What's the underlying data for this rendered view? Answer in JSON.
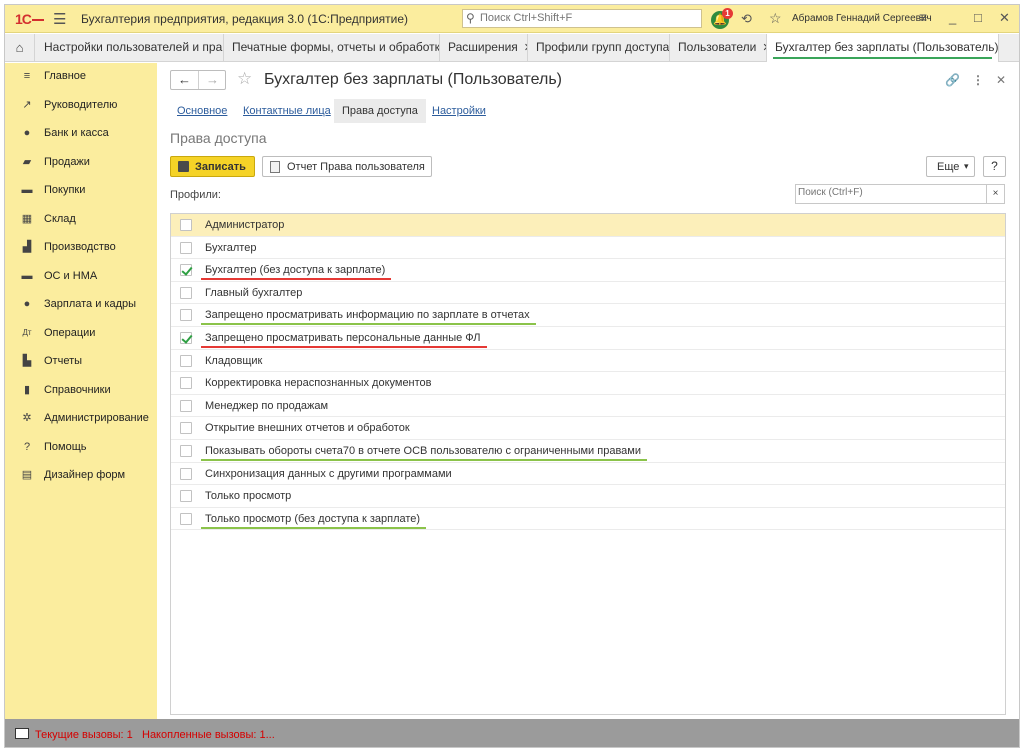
{
  "titlebar": {
    "logo": "1С",
    "app_title": "Бухгалтерия предприятия, редакция 3.0  (1С:Предприятие)",
    "search_placeholder": "Поиск Ctrl+Shift+F",
    "notification_count": "1",
    "user_name": "Абрамов Геннадий Сергеевич"
  },
  "tabs": [
    {
      "label": "Настройки пользователей и прав"
    },
    {
      "label": "Печатные формы, отчеты и обработки"
    },
    {
      "label": "Расширения"
    },
    {
      "label": "Профили групп доступа"
    },
    {
      "label": "Пользователи"
    },
    {
      "label": "Бухгалтер без зарплаты (Пользователь)",
      "active": true
    }
  ],
  "sidebar": {
    "items": [
      {
        "label": "Главное",
        "icon": "menu-icon"
      },
      {
        "label": "Руководителю",
        "icon": "trend-icon"
      },
      {
        "label": "Банк и касса",
        "icon": "ruble-icon"
      },
      {
        "label": "Продажи",
        "icon": "bag-icon"
      },
      {
        "label": "Покупки",
        "icon": "cart-icon"
      },
      {
        "label": "Склад",
        "icon": "warehouse-icon"
      },
      {
        "label": "Производство",
        "icon": "factory-icon"
      },
      {
        "label": "ОС и НМА",
        "icon": "truck-icon"
      },
      {
        "label": "Зарплата и кадры",
        "icon": "person-icon"
      },
      {
        "label": "Операции",
        "icon": "dt-kt-icon"
      },
      {
        "label": "Отчеты",
        "icon": "bar-chart-icon"
      },
      {
        "label": "Справочники",
        "icon": "book-icon"
      },
      {
        "label": "Администрирование",
        "icon": "gear-icon"
      },
      {
        "label": "Помощь",
        "icon": "question-icon"
      },
      {
        "label": "Дизайнер форм",
        "icon": "form-icon"
      }
    ]
  },
  "page": {
    "title": "Бухгалтер без зарплаты (Пользователь)",
    "form_tabs": [
      {
        "label": "Основное"
      },
      {
        "label": "Контактные лица"
      },
      {
        "label": "Права доступа",
        "active": true
      },
      {
        "label": "Настройки"
      }
    ],
    "section_title": "Права доступа",
    "save_button": "Записать",
    "report_button": "Отчет Права пользователя",
    "more_button": "Еще",
    "help_button": "?",
    "profiles_label": "Профили:",
    "search_placeholder": "Поиск (Ctrl+F)",
    "clear_symbol": "×"
  },
  "profiles": [
    {
      "label": "Администратор",
      "checked": false,
      "selected": true,
      "underline": null
    },
    {
      "label": "Бухгалтер",
      "checked": false,
      "underline": null
    },
    {
      "label": "Бухгалтер (без доступа к зарплате)",
      "checked": true,
      "underline": "#e53935"
    },
    {
      "label": "Главный бухгалтер",
      "checked": false,
      "underline": null
    },
    {
      "label": "Запрещено просматривать информацию по зарплате в отчетах",
      "checked": false,
      "underline": "#8bc34a"
    },
    {
      "label": "Запрещено просматривать персональные данные ФЛ",
      "checked": true,
      "underline": "#e53935"
    },
    {
      "label": "Кладовщик",
      "checked": false,
      "underline": null
    },
    {
      "label": "Корректировка нераспознанных документов",
      "checked": false,
      "underline": null
    },
    {
      "label": "Менеджер по продажам",
      "checked": false,
      "underline": null
    },
    {
      "label": "Открытие внешних отчетов и обработок",
      "checked": false,
      "underline": null
    },
    {
      "label": "Показывать обороты счета70 в отчете ОСВ пользователю с ограниченными правами",
      "checked": false,
      "underline": "#8bc34a"
    },
    {
      "label": "Синхронизация данных с другими программами",
      "checked": false,
      "underline": null
    },
    {
      "label": "Только просмотр",
      "checked": false,
      "underline": null
    },
    {
      "label": "Только просмотр (без доступа к зарплате)",
      "checked": false,
      "underline": "#8bc34a"
    }
  ],
  "statusbar": {
    "current_calls": "Текущие вызовы: 1",
    "accumulated_calls": "Накопленные вызовы: 1..."
  }
}
